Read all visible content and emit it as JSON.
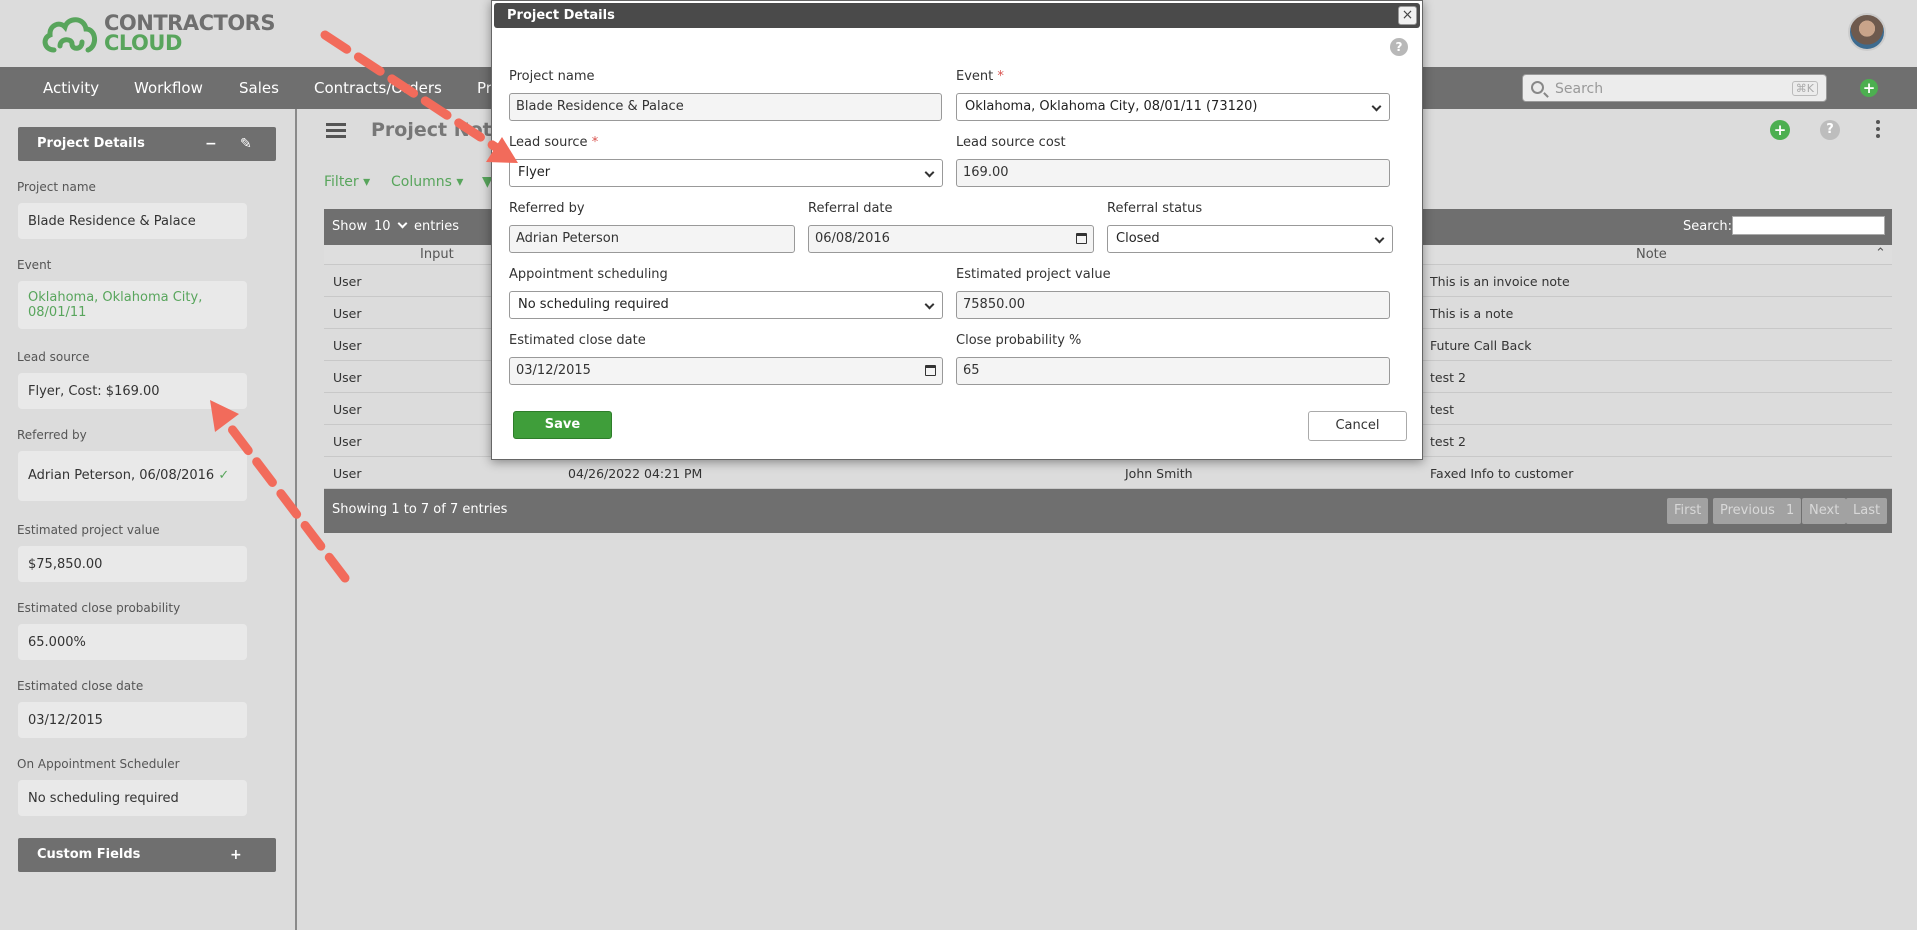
{
  "brand": {
    "line1": "CONTRACTORS",
    "line2": "CLOUD"
  },
  "nav": {
    "items": [
      "Activity",
      "Workflow",
      "Sales",
      "Contracts/Orders",
      "Pr"
    ]
  },
  "search": {
    "placeholder": "Search",
    "shortcut": "⌘K"
  },
  "sidebar": {
    "panel_title": "Project Details",
    "fields": [
      {
        "label": "Project name",
        "value": "Blade Residence & Palace"
      },
      {
        "label": "Event",
        "value": "Oklahoma, Oklahoma City, 08/01/11"
      },
      {
        "label": "Lead source",
        "value": "Flyer, Cost: $169.00"
      },
      {
        "label": "Referred by",
        "value": "Adrian Peterson, 06/08/2016",
        "check": "✓"
      },
      {
        "label": "Estimated project value",
        "value": "$75,850.00"
      },
      {
        "label": "Estimated close probability",
        "value": "65.000%"
      },
      {
        "label": "Estimated close date",
        "value": "03/12/2015"
      },
      {
        "label": "On Appointment Scheduler",
        "value": "No scheduling required"
      }
    ],
    "custom_fields_title": "Custom Fields"
  },
  "main": {
    "title": "Project Notes",
    "filter_label": "Filter",
    "columns_label": "Columns",
    "table": {
      "show_label": "Show",
      "show_value": "10",
      "entries_label": "entries",
      "search_label": "Search:",
      "headers": {
        "input": "Input",
        "note": "Note"
      },
      "rows": [
        {
          "input": "User",
          "date": "",
          "author": "",
          "note": "This is an invoice note"
        },
        {
          "input": "User",
          "date": "",
          "author": "",
          "note": "This is a note"
        },
        {
          "input": "User",
          "date": "",
          "author": "",
          "note": "Future Call Back"
        },
        {
          "input": "User",
          "date": "",
          "author": "",
          "note": "test 2"
        },
        {
          "input": "User",
          "date": "",
          "author": "",
          "note": "test"
        },
        {
          "input": "User",
          "date": "",
          "author": "",
          "note": "test 2"
        },
        {
          "input": "User",
          "date": "04/26/2022 04:21 PM",
          "author": "John Smith",
          "note": "Faxed Info to customer"
        }
      ],
      "footer_info": "Showing 1 to 7 of 7 entries",
      "pagination": [
        "First",
        "Previous",
        "1",
        "Next",
        "Last"
      ]
    }
  },
  "modal": {
    "title": "Project Details",
    "close": "×",
    "help": "?",
    "project_name": {
      "label": "Project name",
      "value": "Blade Residence & Palace"
    },
    "event": {
      "label": "Event",
      "required": "*",
      "value": "Oklahoma, Oklahoma City, 08/01/11 (73120)"
    },
    "lead_source": {
      "label": "Lead source",
      "required": "*",
      "value": "Flyer"
    },
    "lead_source_cost": {
      "label": "Lead source cost",
      "value": "169.00"
    },
    "referred_by": {
      "label": "Referred by",
      "value": "Adrian Peterson"
    },
    "referral_date": {
      "label": "Referral date",
      "value": "06/08/2016"
    },
    "referral_status": {
      "label": "Referral status",
      "value": "Closed"
    },
    "appointment_scheduling": {
      "label": "Appointment scheduling",
      "value": "No scheduling required"
    },
    "estimated_project_value": {
      "label": "Estimated project value",
      "value": "75850.00"
    },
    "estimated_close_date": {
      "label": "Estimated close date",
      "value": "03/12/2015"
    },
    "close_probability": {
      "label": "Close probability %",
      "value": "65"
    },
    "save_label": "Save",
    "cancel_label": "Cancel"
  },
  "colors": {
    "accent_green": "#58a55c",
    "save_green": "#3f9e3a",
    "arrow_red": "#f26b5b",
    "nav_gray": "#6f6f6f"
  }
}
